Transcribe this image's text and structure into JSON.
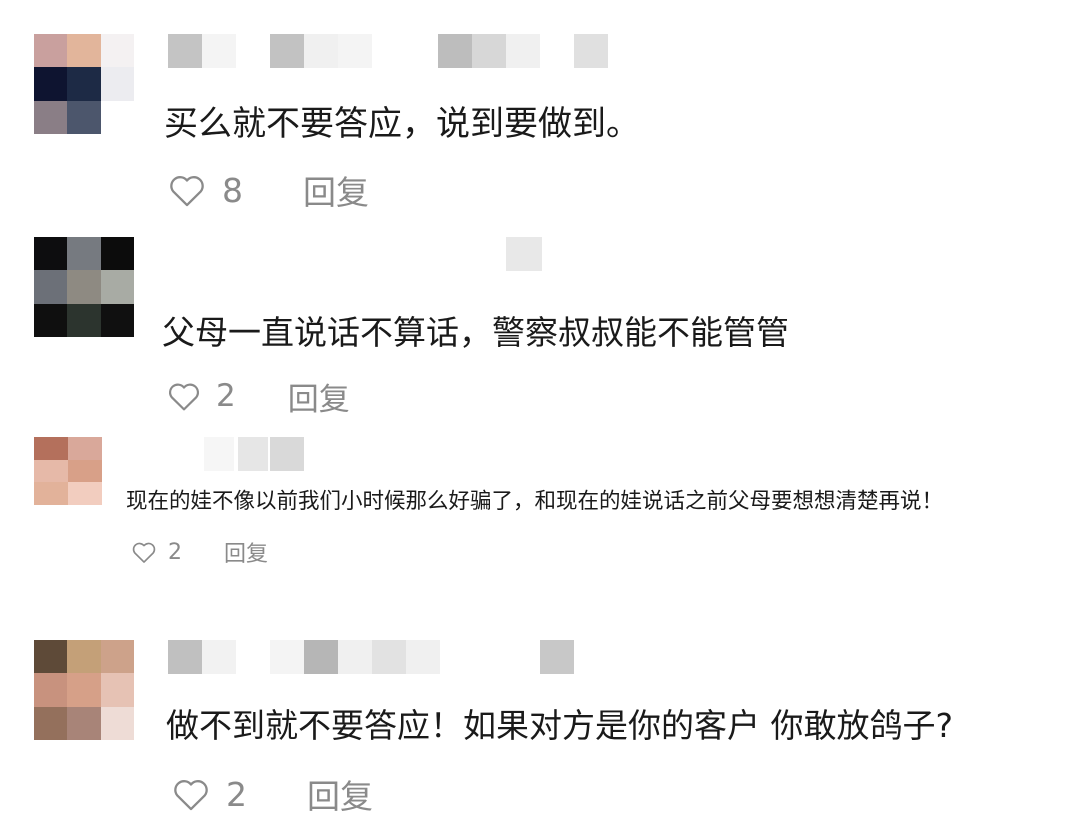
{
  "comments": [
    {
      "text": "买么就不要答应，说到要做到。",
      "likes": "8",
      "reply_label": "回复",
      "avatar_pixels": [
        "#c9a09e",
        "#e2b59b",
        "#f4f1f2",
        "#0e1430",
        "#1d2a45",
        "#ececf0",
        "#8a7e86",
        "#4c566c",
        "#ffffff"
      ],
      "name_pixels": [
        "#c4c4c4",
        "#f4f4f4",
        "#c2c2c2",
        "#f0f0f0",
        "#f4f4f4",
        "#bdbdbd",
        "#d7d7d7",
        "#f0f0f0",
        "#e0e0e0"
      ]
    },
    {
      "text": "父母一直说话不算话，警察叔叔能不能管管",
      "likes": "2",
      "reply_label": "回复",
      "avatar_pixels": [
        "#0d0d0f",
        "#767a80",
        "#0c0c0c",
        "#6c7078",
        "#8e8a82",
        "#a8aba4",
        "#0f0f0f",
        "#2c342e",
        "#101010"
      ],
      "name_pixels": [
        "#e8e8e8"
      ]
    },
    {
      "text": "现在的娃不像以前我们小时候那么好骗了，和现在的娃说话之前父母要想想清楚再说！",
      "likes": "2",
      "reply_label": "回复",
      "avatar_pixels": [
        "#b4705c",
        "#d9a89a",
        "#e6b9a8",
        "#d8a088",
        "#e2b29a",
        "#f2cdbf"
      ],
      "name_pixels": [
        "#f6f6f6",
        "#e6e6e6",
        "#d9d9d9"
      ]
    },
    {
      "text": "做不到就不要答应！如果对方是你的客户 你敢放鸽子?",
      "likes": "2",
      "reply_label": "回复",
      "avatar_pixels": [
        "#5e4a38",
        "#c4a078",
        "#cda28a",
        "#c8927e",
        "#d6a088",
        "#e6c2b4",
        "#94705c",
        "#a88478",
        "#eedcd6"
      ],
      "name_pixels": [
        "#c0c0c0",
        "#f2f2f2",
        "#f4f4f4",
        "#b6b6b6",
        "#f0f0f0",
        "#e2e2e2",
        "#f0f0f0",
        "#c8c8c8"
      ]
    }
  ]
}
